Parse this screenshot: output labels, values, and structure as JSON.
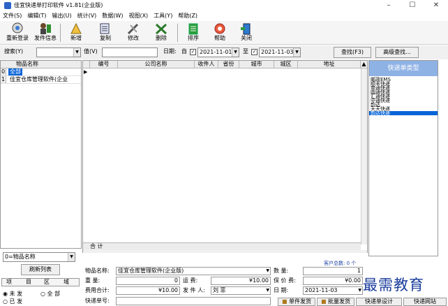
{
  "window": {
    "title": "佳宜快递单打印软件 v1.81(企业版)",
    "minimize": "–",
    "maximize": "☐",
    "close": "✕"
  },
  "menu": [
    "文件(S)",
    "编辑(T)",
    "输出(U)",
    "统计(V)",
    "数据(W)",
    "视图(X)",
    "工具(Y)",
    "帮助(Z)"
  ],
  "toolbar": {
    "relogin": "重新登录",
    "sender": "发件信息",
    "add": "新增",
    "copy": "复制",
    "edit": "修改",
    "delete": "删除",
    "sort": "排序",
    "help": "帮助",
    "close": "关闭"
  },
  "search": {
    "keyword_label": "搜索(Y)",
    "value_label": "值(V)",
    "date_label": "日期:",
    "from": "自",
    "date_from": "2021-11-01",
    "to": "至",
    "date_to": "2021-11-03",
    "find_button": "查找(F3)",
    "advanced_button": "高级查找..."
  },
  "left_grid": {
    "header": "物品名称",
    "rows": [
      {
        "idx": "0",
        "name": "全部"
      },
      {
        "idx": "1",
        "name": "佳宜仓库管理软件(企业"
      }
    ]
  },
  "main_grid": {
    "columns": [
      "编号",
      "公司名称",
      "收件人",
      "省份",
      "城市",
      "城区",
      "地址"
    ],
    "footer_label": "合 计"
  },
  "type_panel": {
    "header": "快递单类型",
    "items": [
      "邮政EMS",
      "顺丰快递",
      "申通快递",
      "圆通快递",
      "汇通快递",
      "中通快递",
      "韵达",
      "天天快递",
      "韵达快递"
    ],
    "selected_index": 8
  },
  "bottom_left": {
    "combo_value": "0=物品名称",
    "refresh_button": "刷新列表",
    "tabs": [
      "项",
      "目",
      "区",
      "域"
    ],
    "options": [
      "未 发",
      "全 部",
      "已 发"
    ]
  },
  "form": {
    "customer_count_label": "客户总数: 0 个",
    "item_label": "物品名称:",
    "item_value": "佳宜仓库管理软件(企业版)",
    "qty_label": "数 量:",
    "qty_value": "1",
    "weight_label": "重 量:",
    "weight_value": "0",
    "freight_label": "运 费:",
    "freight_value": "¥10.00",
    "insure_label": "保 价 费:",
    "insure_value": "¥0.00",
    "total_label": "费用合计:",
    "total_value": "¥10.00",
    "sender_label": "发 件 人:",
    "sender_value": "刘 菲",
    "date_label": "日 期:",
    "date_value": "2021-11-03",
    "tracking_label": "快递单号:"
  },
  "bottom_buttons": {
    "single": "单件发货",
    "batch": "批量发货",
    "design": "快递单设计",
    "site": "快递网站"
  },
  "watermark": "最需教育",
  "colors": {
    "selected": "#0a64d8",
    "panel_header": "#8fb2e5",
    "watermark": "#1a3d9c"
  }
}
